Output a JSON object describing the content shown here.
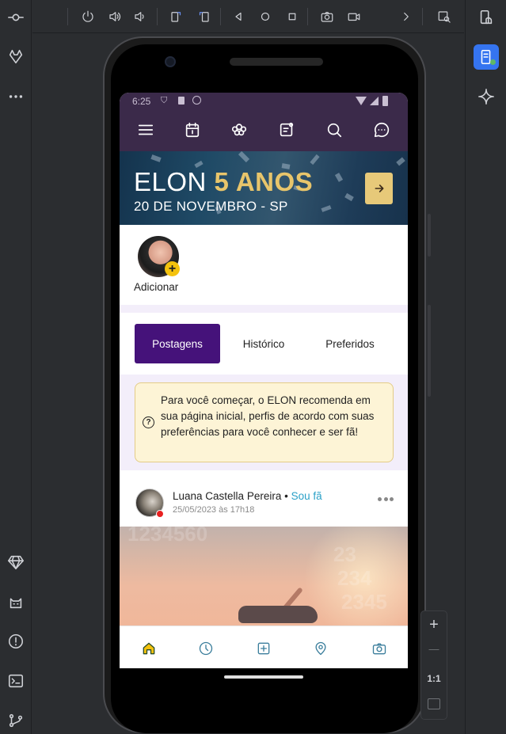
{
  "ide": {
    "left_rail_icons": [
      "commit-icon",
      "gitlab-icon",
      "more-icon",
      "diamond-icon",
      "cat-icon",
      "problems-icon",
      "terminal-icon",
      "git-branch-icon"
    ],
    "toolbar_icons": [
      "power-icon",
      "volume-up-icon",
      "volume-down-icon",
      "rotate-left-icon",
      "rotate-right-icon",
      "back-icon",
      "home-icon",
      "overview-icon",
      "screenshot-icon",
      "record-icon",
      "chevron-right-icon",
      "inspect-icon"
    ],
    "right_rail_icons": [
      "device-manager-icon",
      "running-devices-icon",
      "gemini-icon"
    ],
    "zoom": {
      "plus": "+",
      "minus": "—",
      "ratio": "1:1"
    }
  },
  "device": {
    "status_time": "6:25"
  },
  "app": {
    "banner": {
      "title_prefix": "ELON ",
      "title_highlight": "5 ANOS",
      "subtitle": "20 DE NOVEMBRO - SP",
      "accent": "#e7c979"
    },
    "stories": {
      "add_label": "Adicionar"
    },
    "tabs": [
      {
        "label": "Postagens",
        "active": true
      },
      {
        "label": "Histórico",
        "active": false
      },
      {
        "label": "Preferidos",
        "active": false
      }
    ],
    "notice": {
      "icon": "?",
      "text": "Para você começar, o ELON recomenda em sua página inicial, perfis de acordo com suas preferências para você conhecer e ser fã!"
    },
    "post": {
      "author": "Luana Castella Pereira",
      "separator": " • ",
      "fan_label": "Sou fã",
      "timestamp": "25/05/2023 às 17h18"
    },
    "colors": {
      "primary": "#45127a",
      "appbar": "#3b2a4a",
      "nav_icon": "#3b7e9c",
      "fan_link": "#2aa0c7"
    }
  }
}
